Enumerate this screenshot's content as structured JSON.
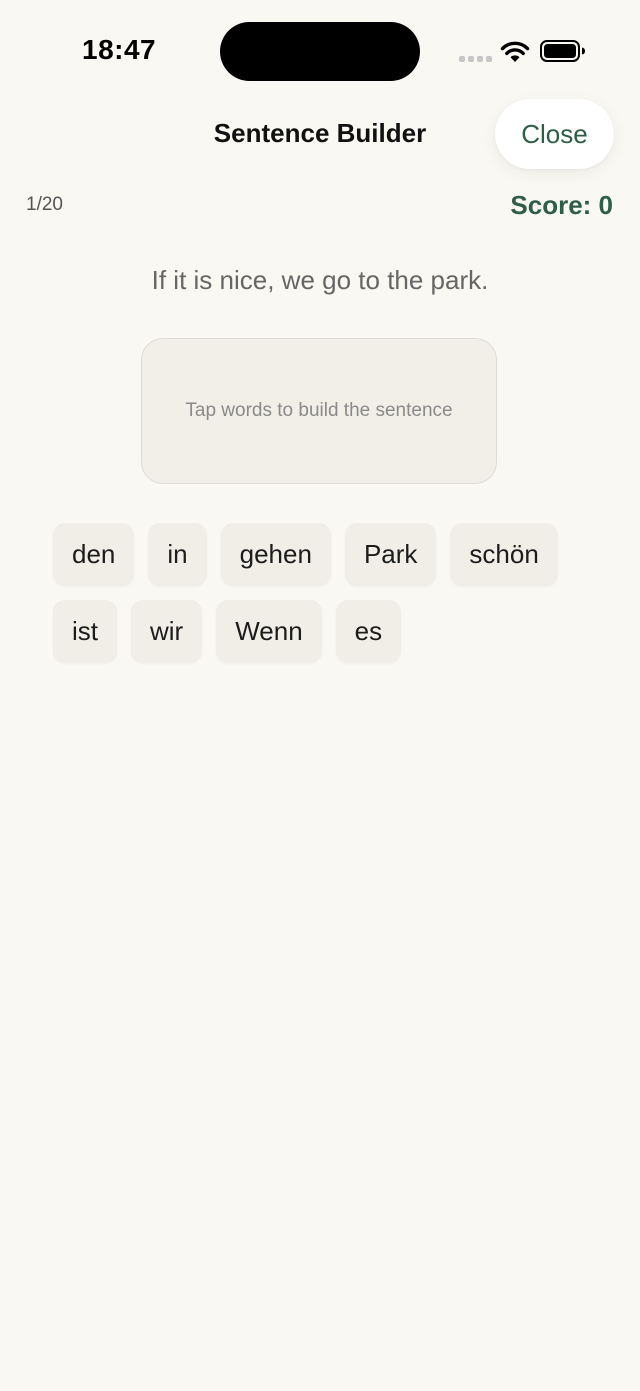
{
  "status_bar": {
    "time": "18:47"
  },
  "header": {
    "title": "Sentence Builder",
    "close_label": "Close"
  },
  "progress": {
    "label": "1/20",
    "score_label": "Score: 0"
  },
  "prompt": {
    "text": "If it is nice, we go to the park."
  },
  "answer_area": {
    "placeholder": "Tap words to build the sentence"
  },
  "word_bank": {
    "rows": [
      [
        "den",
        "in",
        "gehen",
        "Park",
        "schön"
      ],
      [
        "ist",
        "wir",
        "Wenn",
        "es"
      ]
    ]
  },
  "colors": {
    "background": "#faf8f2",
    "accent": "#2e5e45",
    "chip": "#f1eee7"
  },
  "icons": [
    "cellular-signal-icon",
    "wifi-icon",
    "battery-icon"
  ]
}
